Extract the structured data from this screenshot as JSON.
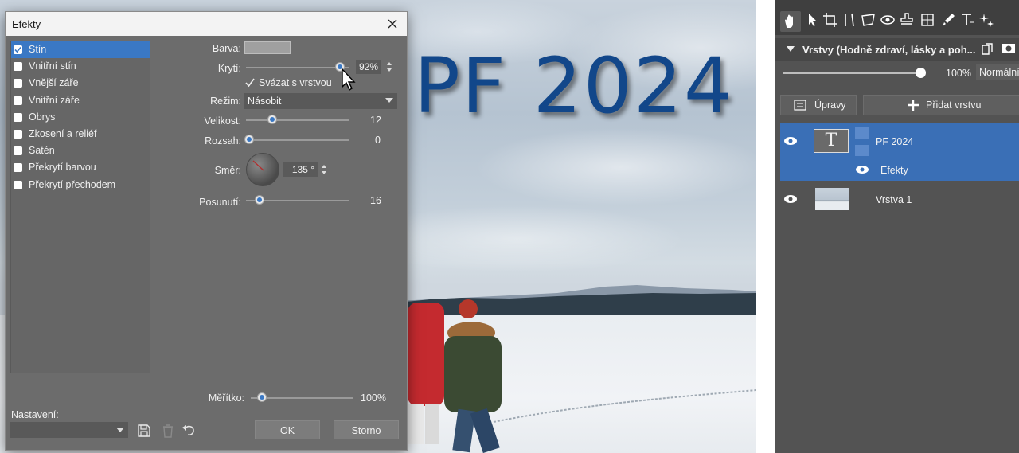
{
  "dialog": {
    "title": "Efekty",
    "effects": [
      {
        "label": "Stín",
        "checked": true,
        "selected": true
      },
      {
        "label": "Vnitřní stín",
        "checked": false
      },
      {
        "label": "Vnější záře",
        "checked": false
      },
      {
        "label": "Vnitřní záře",
        "checked": false
      },
      {
        "label": "Obrys",
        "checked": false
      },
      {
        "label": "Zkosení a reliéf",
        "checked": false
      },
      {
        "label": "Satén",
        "checked": false
      },
      {
        "label": "Překrytí barvou",
        "checked": false
      },
      {
        "label": "Překrytí přechodem",
        "checked": false
      }
    ],
    "color_label": "Barva:",
    "color_value": "#a0a0a0",
    "opacity_label": "Krytí:",
    "opacity_value": "92%",
    "opacity_fraction": 0.92,
    "link_label": "Svázat s vrstvou",
    "link_checked": true,
    "mode_label": "Režim:",
    "mode_value": "Násobit",
    "size_label": "Velikost:",
    "size_value": "12",
    "range_label": "Rozsah:",
    "range_value": "0",
    "direction_label": "Směr:",
    "direction_value": "135 °",
    "offset_label": "Posunutí:",
    "offset_value": "16",
    "scale_label": "Měřítko:",
    "scale_value": "100%",
    "preset_label": "Nastavení:",
    "ok_label": "OK",
    "cancel_label": "Storno"
  },
  "canvas": {
    "title_text": "PF 2024",
    "title_color": "#12478a"
  },
  "panel": {
    "layers_title": "Vrstvy (Hodně zdraví, lásky a poh...",
    "opacity_value": "100%",
    "blend_mode": "Normální",
    "adjustments_label": "Úpravy",
    "add_layer_label": "Přidat vrstvu",
    "layers": [
      {
        "name": "PF 2024",
        "type": "text",
        "thumb_glyph": "T",
        "effects_label": "Efekty",
        "selected": true
      },
      {
        "name": "Vrstva 1",
        "type": "image",
        "selected": false
      }
    ],
    "accent": "#3a6fb6"
  }
}
